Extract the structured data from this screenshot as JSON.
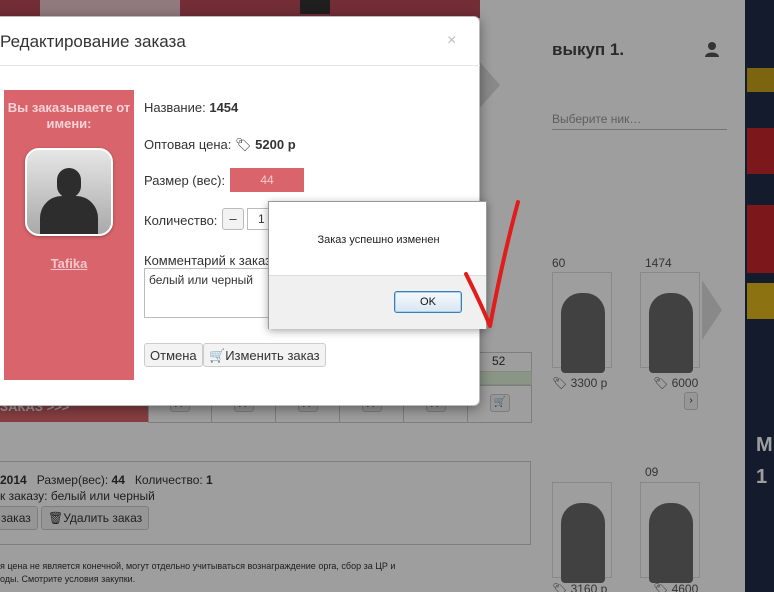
{
  "background": {
    "heading": "выкуп 1.",
    "select_text": "Выберите ник…",
    "table_header_value": "52",
    "thumb_labels": [
      "60",
      "1474",
      "09"
    ],
    "prices": [
      "3300 р",
      "6000",
      "3160 р",
      "4600"
    ],
    "pink_strip_text": "ЗАКАЗ >>>",
    "order_line1_prefix": "2014",
    "order_line1_size_label": "Размер(вес):",
    "order_line1_size_value": "44",
    "order_line1_qty_label": "Количество:",
    "order_line1_qty_value": "1",
    "order_line2": "к заказу: белый или черный",
    "edit_order_button": "заказ",
    "delete_order_button": "Удалить заказ",
    "footnote_line1": "я цена не является конечной, могут отдельно учитываться вознаграждение орга, сбор за ЦР и",
    "footnote_line2": "оды. Смотрите условия закупки.",
    "rail_text_1": "М",
    "rail_text_2": "1"
  },
  "modal": {
    "title": "Редактирование заказа",
    "close_glyph": "×",
    "ordering_as_label": "Вы заказываете от имени:",
    "username": "Tafika",
    "name_label": "Название:",
    "name_value": "1454",
    "price_label": "Оптовая цена:",
    "price_value": "5200 р",
    "size_label": "Размер (вес):",
    "size_value": "44",
    "qty_label": "Количество:",
    "qty_minus": "–",
    "qty_value": "1",
    "comment_label": "Комментарий к заказу:",
    "comment_value": "белый или черный",
    "cancel_button": "Отмена",
    "save_button": "Изменить заказ"
  },
  "alert": {
    "message": "Заказ успешно изменен",
    "ok_button": "OK"
  },
  "colors": {
    "accent_pink": "#d9646b",
    "annotation_red": "#e21b1b"
  }
}
